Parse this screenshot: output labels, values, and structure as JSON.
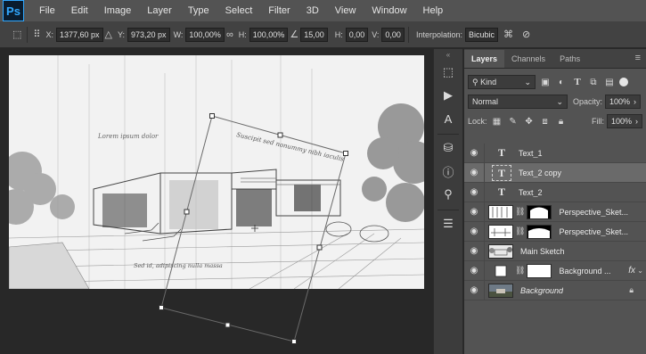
{
  "app": {
    "logo": "Ps"
  },
  "menu": [
    "File",
    "Edit",
    "Image",
    "Layer",
    "Type",
    "Select",
    "Filter",
    "3D",
    "View",
    "Window",
    "Help"
  ],
  "options": {
    "x_label": "X:",
    "x_value": "1377,60 px",
    "y_label": "Y:",
    "y_value": "973,20 px",
    "w_label": "W:",
    "w_value": "100,00%",
    "h_label": "H:",
    "h_value": "100,00%",
    "angle_value": "15,00",
    "hskew_label": "H:",
    "hskew_value": "0,00",
    "vskew_label": "V:",
    "vskew_value": "0,00",
    "interp_label": "Interpolation:",
    "interp_value": "Bicubic"
  },
  "doc_text": {
    "script1": "Lorem ipsum dolor",
    "script2": "Suscipit sed nonummy nibh iaculis",
    "script3": "Sed id, adipiscing nulla massa"
  },
  "panel": {
    "tabs": [
      "Layers",
      "Channels",
      "Paths"
    ],
    "active_tab": "Layers",
    "filter_kind": "Kind",
    "blend_mode": "Normal",
    "opacity_label": "Opacity:",
    "opacity_value": "100%",
    "lock_label": "Lock:",
    "fill_label": "Fill:",
    "fill_value": "100%"
  },
  "layers": [
    {
      "name": "Text_1",
      "type": "text"
    },
    {
      "name": "Text_2 copy",
      "type": "text",
      "selected": true
    },
    {
      "name": "Text_2",
      "type": "text"
    },
    {
      "name": "Perspective_Sket...",
      "type": "masked"
    },
    {
      "name": "Perspective_Sket...",
      "type": "masked"
    },
    {
      "name": "Main Sketch",
      "type": "image"
    },
    {
      "name": "Background ...",
      "type": "fill",
      "fx": "fx"
    },
    {
      "name": "Background",
      "type": "background",
      "locked": true
    }
  ],
  "colors": {
    "accent": "#31a8ff",
    "panel": "#535353",
    "selected": "#6a6a6a"
  }
}
